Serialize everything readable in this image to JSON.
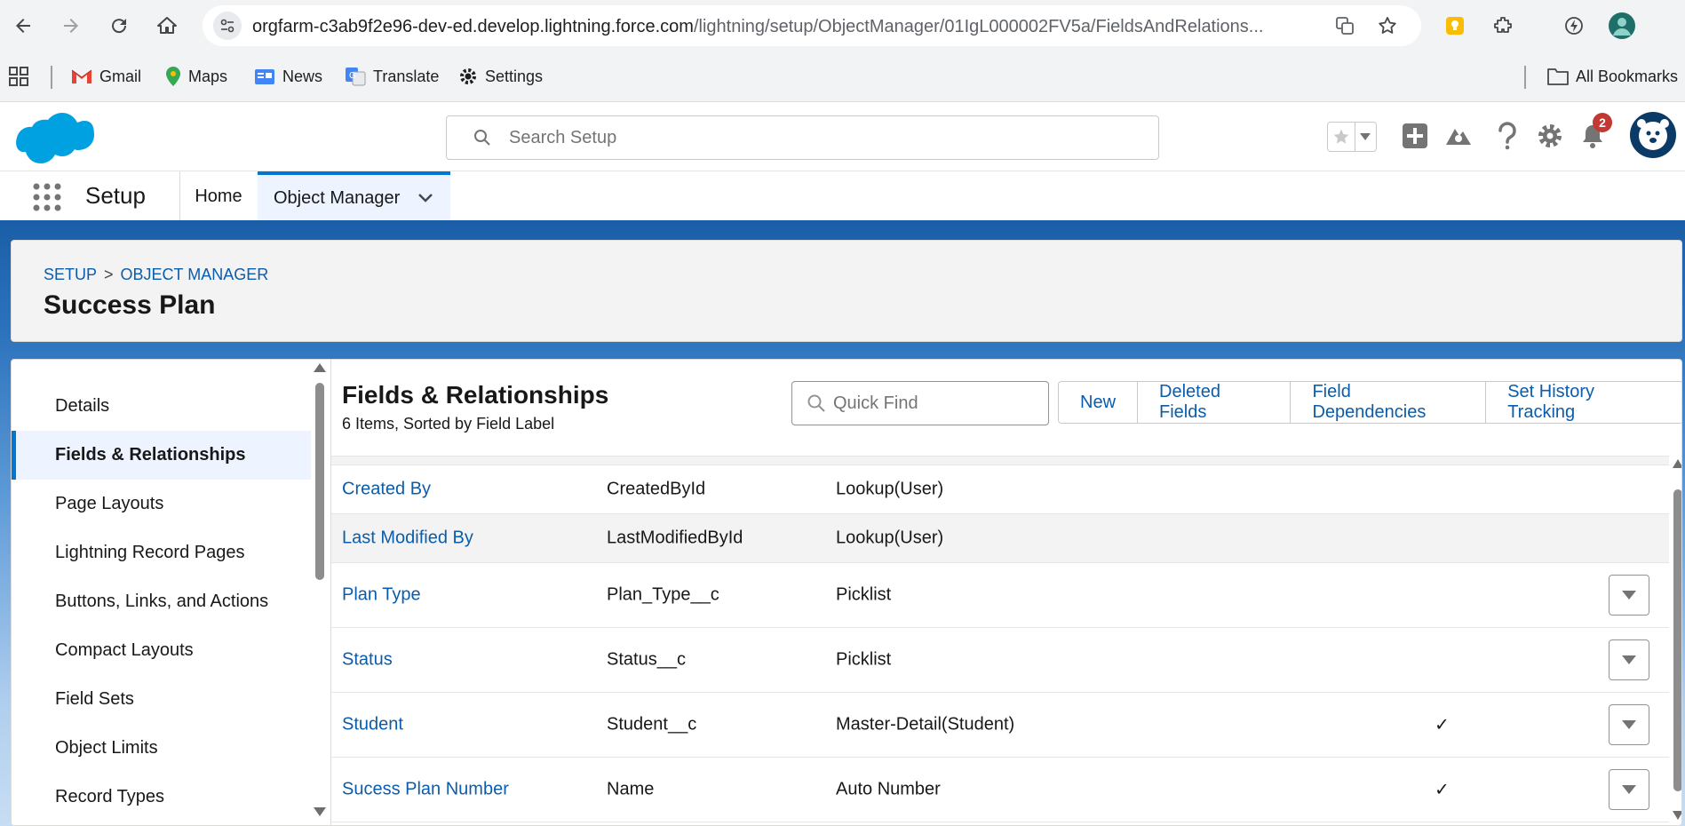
{
  "browser": {
    "url_host": "orgfarm-c3ab9f2e96-dev-ed.develop.lightning.force.com",
    "url_path": "/lightning/setup/ObjectManager/01IgL000002FV5a/FieldsAndRelations...",
    "bookmarks": [
      {
        "label": "Gmail"
      },
      {
        "label": "Maps"
      },
      {
        "label": "News"
      },
      {
        "label": "Translate"
      },
      {
        "label": "Settings"
      }
    ],
    "all_bookmarks_label": "All Bookmarks"
  },
  "header": {
    "search_placeholder": "Search Setup",
    "notification_count": "2"
  },
  "nav": {
    "app_name": "Setup",
    "tabs": [
      {
        "label": "Home"
      },
      {
        "label": "Object Manager"
      }
    ]
  },
  "page": {
    "breadcrumb": [
      "SETUP",
      "OBJECT MANAGER"
    ],
    "breadcrumb_sep": ">",
    "title": "Success Plan"
  },
  "sidebar": {
    "items": [
      {
        "label": "Details"
      },
      {
        "label": "Fields & Relationships"
      },
      {
        "label": "Page Layouts"
      },
      {
        "label": "Lightning Record Pages"
      },
      {
        "label": "Buttons, Links, and Actions"
      },
      {
        "label": "Compact Layouts"
      },
      {
        "label": "Field Sets"
      },
      {
        "label": "Object Limits"
      },
      {
        "label": "Record Types"
      }
    ],
    "active_index": 1
  },
  "section": {
    "title": "Fields & Relationships",
    "subtitle": "6 Items, Sorted by Field Label",
    "quick_find_placeholder": "Quick Find",
    "buttons": [
      {
        "label": "New"
      },
      {
        "label": "Deleted Fields"
      },
      {
        "label": "Field Dependencies"
      },
      {
        "label": "Set History Tracking"
      }
    ]
  },
  "fields": [
    {
      "label": "Created By",
      "api": "CreatedById",
      "type": "Lookup(User)",
      "indexed": false,
      "has_action": false
    },
    {
      "label": "Last Modified By",
      "api": "LastModifiedById",
      "type": "Lookup(User)",
      "indexed": false,
      "has_action": false
    },
    {
      "label": "Plan Type",
      "api": "Plan_Type__c",
      "type": "Picklist",
      "indexed": false,
      "has_action": true
    },
    {
      "label": "Status",
      "api": "Status__c",
      "type": "Picklist",
      "indexed": false,
      "has_action": true
    },
    {
      "label": "Student",
      "api": "Student__c",
      "type": "Master-Detail(Student)",
      "indexed": true,
      "has_action": true
    },
    {
      "label": "Sucess Plan Number",
      "api": "Name",
      "type": "Auto Number",
      "indexed": true,
      "has_action": true
    }
  ],
  "check_glyph": "✓",
  "colors": {
    "brand_blue": "#0176d3",
    "link_blue": "#0b5cab",
    "salesforce_cloud": "#00a1e0"
  }
}
